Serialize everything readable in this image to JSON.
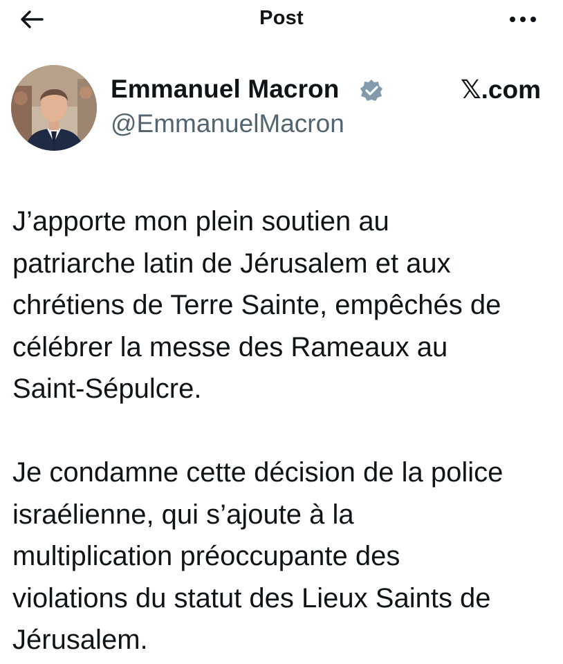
{
  "header": {
    "title": "Post",
    "back_icon": "arrow-left-icon",
    "more_icon": "more-horizontal-icon"
  },
  "author": {
    "name": "Emmanuel Macron",
    "handle": "@EmmanuelMacron",
    "verified_badge": "verified-badge-icon",
    "verified_color": "#829aab"
  },
  "site_label": "𝕏.com",
  "post": {
    "paragraphs": [
      "J’apporte mon plein soutien au patriarche latin de Jérusalem et aux chrétiens de Terre Sainte, empêchés de célébrer la messe des Rameaux au Saint-Sépulcre.",
      "Je condamne cette décision de la police israélienne, qui s’ajoute à la multiplication préoccupante des violations du statut des Lieux Saints de Jérusalem."
    ],
    "text": "J’apporte mon plein soutien au\npatriarche latin de Jérusalem et aux\nchrétiens de Terre Sainte, empêchés de\ncélébrer la messe des Rameaux au\nSaint-Sépulcre.\n\nJe condamne cette décision de la police\nisraélienne, qui s’ajoute à la\nmultiplication préoccupante des\nviolations du statut des Lieux Saints de\nJérusalem."
  },
  "colors": {
    "text": "#0f1419",
    "secondary_text": "#536471",
    "background": "#ffffff"
  }
}
